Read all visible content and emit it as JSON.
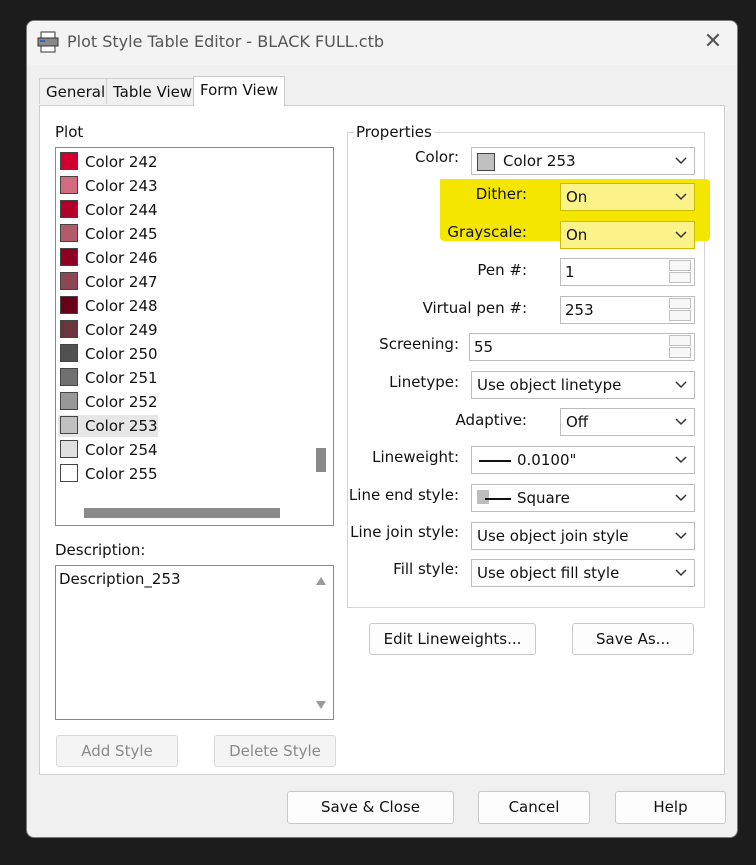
{
  "window": {
    "title": "Plot Style Table Editor - BLACK FULL.ctb"
  },
  "tabs": [
    "General",
    "Table View",
    "Form View"
  ],
  "plot": {
    "label": "Plot",
    "items": [
      {
        "label": "Color 242",
        "color": "#d3002f"
      },
      {
        "label": "Color 243",
        "color": "#d46a7e"
      },
      {
        "label": "Color 244",
        "color": "#b3002a"
      },
      {
        "label": "Color 245",
        "color": "#b35a6b"
      },
      {
        "label": "Color 246",
        "color": "#8c0021"
      },
      {
        "label": "Color 247",
        "color": "#8c4654"
      },
      {
        "label": "Color 248",
        "color": "#680018"
      },
      {
        "label": "Color 249",
        "color": "#68343e"
      },
      {
        "label": "Color 250",
        "color": "#505050"
      },
      {
        "label": "Color 251",
        "color": "#707070"
      },
      {
        "label": "Color 252",
        "color": "#989898"
      },
      {
        "label": "Color 253",
        "color": "#c0c0c0"
      },
      {
        "label": "Color 254",
        "color": "#e0e0e0"
      },
      {
        "label": "Color 255",
        "color": "#ffffff"
      }
    ],
    "selected_index": 11
  },
  "description": {
    "label": "Description:",
    "value": "Description_253"
  },
  "buttons": {
    "add_style": "Add Style",
    "delete_style": "Delete Style",
    "edit_lineweights": "Edit Lineweights...",
    "save_as": "Save As...",
    "save_close": "Save & Close",
    "cancel": "Cancel",
    "help": "Help"
  },
  "properties": {
    "title": "Properties",
    "color": {
      "label": "Color:",
      "value": "Color 253",
      "swatch": "#c0c0c0"
    },
    "dither": {
      "label": "Dither:",
      "value": "On"
    },
    "grayscale": {
      "label": "Grayscale:",
      "value": "On"
    },
    "pen": {
      "label": "Pen #:",
      "value": "1"
    },
    "virtual_pen": {
      "label": "Virtual pen #:",
      "value": "253"
    },
    "screening": {
      "label": "Screening:",
      "value": "55"
    },
    "linetype": {
      "label": "Linetype:",
      "value": "Use object linetype"
    },
    "adaptive": {
      "label": "Adaptive:",
      "value": "Off"
    },
    "lineweight": {
      "label": "Lineweight:",
      "value": "0.0100\""
    },
    "line_end": {
      "label": "Line end style:",
      "value": "Square"
    },
    "line_join": {
      "label": "Line join style:",
      "value": "Use object join style"
    },
    "fill": {
      "label": "Fill style:",
      "value": "Use object fill style"
    }
  },
  "highlight_color": "#f5e600"
}
